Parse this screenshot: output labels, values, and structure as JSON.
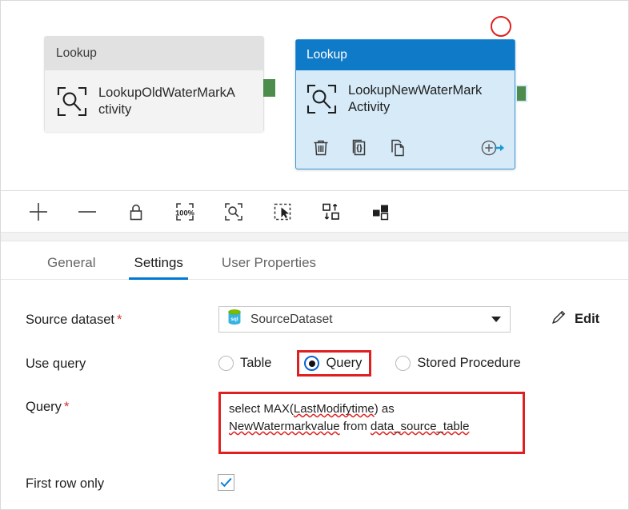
{
  "canvas": {
    "nodes": [
      {
        "type_label": "Lookup",
        "name": "LookupOldWaterMarkActivity",
        "state": "normal",
        "icon": "lookup-icon"
      },
      {
        "type_label": "Lookup",
        "name": "LookupNewWaterMarkActivity",
        "state": "selected",
        "icon": "lookup-icon",
        "actions": [
          {
            "name": "delete",
            "icon": "trash-icon"
          },
          {
            "name": "code",
            "icon": "code-braces-icon"
          },
          {
            "name": "clone",
            "icon": "copy-icon"
          },
          {
            "name": "add-output",
            "icon": "add-arrow-icon"
          }
        ]
      }
    ],
    "annotation": {
      "shape": "circle",
      "color": "#e02020"
    },
    "connector_color": "#4e8c4e",
    "selected_header_color": "#0f7ac8",
    "selected_body_color": "#d6eaf8"
  },
  "toolbar": {
    "buttons": [
      {
        "label": "Zoom in",
        "icon": "plus-icon"
      },
      {
        "label": "Zoom out",
        "icon": "minus-icon"
      },
      {
        "label": "Lock canvas",
        "icon": "lock-icon"
      },
      {
        "label": "Zoom to 100%",
        "icon": "zoom-100-percent-icon"
      },
      {
        "label": "Zoom to fit",
        "icon": "zoom-fit-icon"
      },
      {
        "label": "Select mode",
        "icon": "marquee-select-icon"
      },
      {
        "label": "Auto align",
        "icon": "auto-align-icon"
      },
      {
        "label": "Show related",
        "icon": "squares-icon"
      }
    ]
  },
  "tabs": [
    {
      "label": "General",
      "active": false
    },
    {
      "label": "Settings",
      "active": true
    },
    {
      "label": "User Properties",
      "active": false
    }
  ],
  "form": {
    "source_dataset": {
      "label": "Source dataset",
      "required_marker": "*",
      "value": "SourceDataset",
      "icon": "sql-database-icon",
      "edit_label": "Edit",
      "edit_icon": "pencil-icon"
    },
    "use_query": {
      "label": "Use query",
      "options": [
        {
          "label": "Table",
          "selected": false,
          "highlighted": false
        },
        {
          "label": "Query",
          "selected": true,
          "highlighted": true
        },
        {
          "label": "Stored Procedure",
          "selected": false,
          "highlighted": false
        }
      ]
    },
    "query": {
      "label": "Query",
      "required_marker": "*",
      "value": "select MAX(LastModifytime) as NewWatermarkvalue from data_source_table",
      "line1_a": "select MAX(",
      "line1_b": "LastModifytime",
      "line1_c": ") as",
      "line2_a": "NewWatermarkvalue",
      "line2_b": " from ",
      "line2_c": "data_source_table",
      "highlighted": true
    },
    "first_row_only": {
      "label": "First row only",
      "checked": true,
      "check_color": "#0b7fd4"
    }
  }
}
